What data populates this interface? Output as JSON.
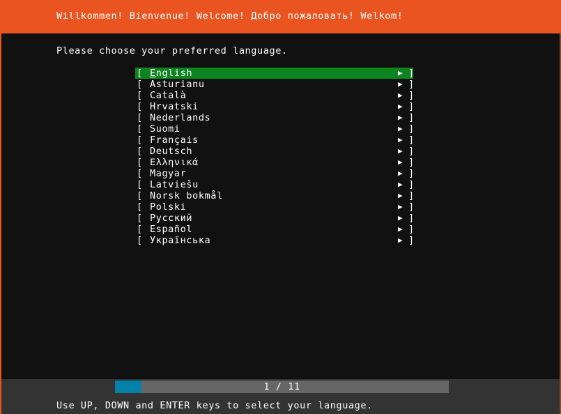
{
  "header": {
    "title": "Willkommen! Bienvenue! Welcome! Добро пожаловать! Welkom!",
    "background_color": "#e95420"
  },
  "main": {
    "prompt": "Please choose your preferred language.",
    "bracket_open": "[",
    "bracket_close": "]",
    "submenu_arrow_icon": "▶",
    "selected_index": 0,
    "selected_color": "#0e8420",
    "languages": [
      {
        "label": "English",
        "accel": "E",
        "rest": "nglish"
      },
      {
        "label": "Asturianu"
      },
      {
        "label": "Català"
      },
      {
        "label": "Hrvatski"
      },
      {
        "label": "Nederlands"
      },
      {
        "label": "Suomi"
      },
      {
        "label": "Français"
      },
      {
        "label": "Deutsch"
      },
      {
        "label": "Ελληνικά"
      },
      {
        "label": "Magyar"
      },
      {
        "label": "Latviešu"
      },
      {
        "label": "Norsk bokmål"
      },
      {
        "label": "Polski"
      },
      {
        "label": "Русский"
      },
      {
        "label": "Español"
      },
      {
        "label": "Українська"
      }
    ]
  },
  "footer": {
    "progress": {
      "label": "1 / 11",
      "current": 1,
      "total": 11,
      "percent": 8,
      "fill_color": "#0481a8",
      "track_color": "#666666"
    },
    "hint": "Use UP, DOWN and ENTER keys to select your language.",
    "background_color": "#333333"
  }
}
